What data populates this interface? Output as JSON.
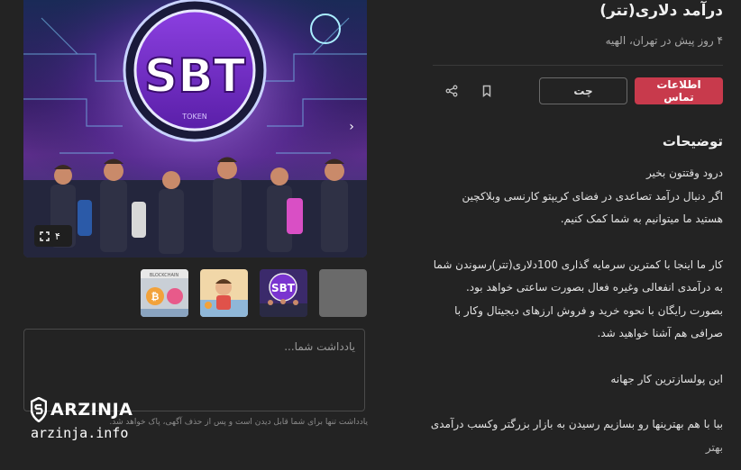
{
  "listing": {
    "title": "درآمد دلاری(تتر)",
    "subtitle": "۴ روز پیش در تهران، الهیه"
  },
  "actions": {
    "contact_label": "اطلاعات تماس",
    "chat_label": "چت",
    "bookmark_icon": "bookmark-icon",
    "share_icon": "share-icon"
  },
  "gallery": {
    "count": "۴",
    "main_image_text": "SBT",
    "main_image_subtext": "TOKEN",
    "thumbnails": [
      "placeholder",
      "sbt-token",
      "child-illustration",
      "blockchain-coins"
    ],
    "thumb_label": "BLOCKCHAIN"
  },
  "note": {
    "placeholder": "یادداشت شما...",
    "hint": "یادداشت تنها برای شما قابل دیدن است و پس از حذف آگهی، پاک خواهد شد."
  },
  "description": {
    "title": "توضیحات",
    "lines": [
      "درود وقتتون بخیر",
      "اگر دنبال درآمد تصاعدی در فضای کریپتو کارنسی وبلاکچین",
      "هستید ما میتوانیم به شما کمک کنیم.",
      "",
      "کار ما اینجا با کمترین سرمایه گذاری 100دلاری(تتر)رسوندن شما",
      "به درآمدی انفعالی وغیره فعال بصورت ساعتی خواهد بود.",
      "بصورت رایگان با نحوه خرید و فروش ارزهای دیجیتال وکار با",
      "صرافی هم آشنا خواهید شد.",
      "",
      "این پولسازترین کار جهانه",
      "",
      "بیا با هم بهترینها رو بسازیم رسیدن به بازار بزرگتر وکسب درآمدی",
      "بهتر"
    ]
  },
  "watermark": {
    "brand": "ARZINJA",
    "url": "arzinja.info"
  },
  "colors": {
    "background": "#232323",
    "accent": "#c83a4c"
  }
}
